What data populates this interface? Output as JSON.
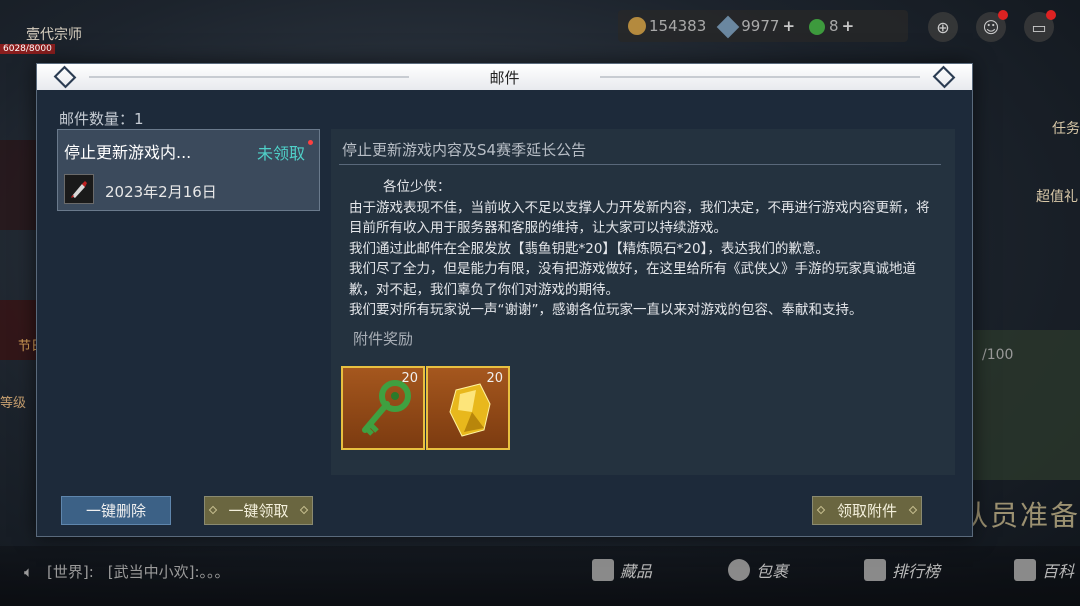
{
  "hud": {
    "player_name": "壹代宗师",
    "player_exp": "6028/8000",
    "currency": {
      "coins": "154383",
      "gems": "9977",
      "jade": "8"
    },
    "side_right": [
      "任务",
      "超值礼"
    ],
    "side_left": [
      "节日活动",
      "等级"
    ],
    "progress_text": "/100",
    "recruit_text": "等待队员准备",
    "chat": {
      "channel": "[世界]:",
      "message": "[武当中小欢]:。。。"
    },
    "bottom_nav": [
      "藏品",
      "包裹",
      "排行榜",
      "百科"
    ]
  },
  "modal": {
    "title": "邮件",
    "mail_count": "邮件数量：1",
    "mail_item": {
      "title": "停止更新游戏内...",
      "status": "未领取",
      "date": "2023年2月16日"
    },
    "content": {
      "title": "停止更新游戏内容及S4赛季延长公告",
      "greeting": "各位少侠：",
      "paragraphs": [
        "由于游戏表现不佳，当前收入不足以支撑人力开发新内容，我们决定，不再进行游戏内容更新，将目前所有收入用于服务器和客服的维持，让大家可以持续游戏。",
        "我们通过此邮件在全服发放【翡鱼钥匙*20】【精炼陨石*20】，表达我们的歉意。",
        "我们尽了全力，但是能力有限，没有把游戏做好，在这里给所有《武侠乂》手游的玩家真诚地道歉，对不起，我们辜负了你们对游戏的期待。",
        "我们要对所有玩家说一声“谢谢”，感谢各位玩家一直以来对游戏的包容、奉献和支持。"
      ],
      "attachment_label": "附件奖励",
      "attachments": [
        {
          "name": "翡鱼钥匙",
          "icon": "jade-key-icon",
          "qty": "20"
        },
        {
          "name": "精炼陨石",
          "icon": "gold-crystal-icon",
          "qty": "20"
        }
      ]
    },
    "buttons": {
      "delete_all": "一键删除",
      "claim_all": "一键领取",
      "claim": "领取附件"
    }
  }
}
